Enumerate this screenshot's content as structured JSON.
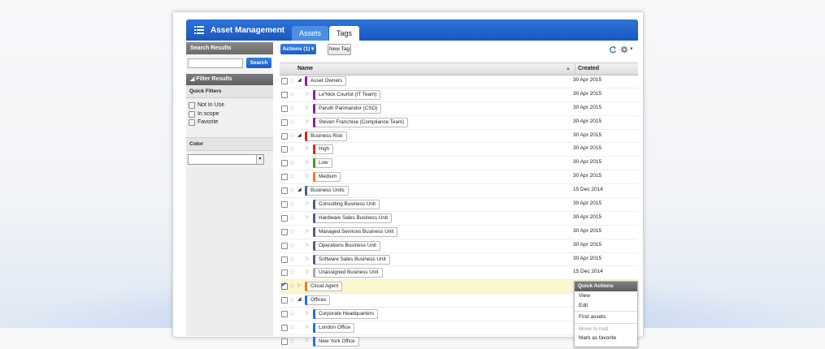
{
  "app": {
    "title": "Asset Management",
    "tabs": [
      "Assets",
      "Tags"
    ],
    "active_tab": "Tags"
  },
  "sidebar": {
    "search_header": "Search Results",
    "search_value": "",
    "search_button": "Search",
    "filter_header": "Filter Results",
    "quick_filters_label": "Quick Filters",
    "quick_filters": [
      "Not In Use",
      "In scope",
      "Favorite"
    ],
    "color_label": "Color",
    "color_value": ""
  },
  "toolbar": {
    "actions_label": "Actions (1)",
    "new_tag_label": "New Tag"
  },
  "table": {
    "columns": [
      "Name",
      "Created"
    ],
    "rows": [
      {
        "name": "Asset Owners",
        "created": "30 Apr 2015",
        "level": 0,
        "color": "#8a1e9e",
        "expanded": true,
        "checked": false
      },
      {
        "name": "Le'Nick Courtot (IT Team)",
        "created": "30 Apr 2015",
        "level": 1,
        "color": "#8a1e9e",
        "checked": false
      },
      {
        "name": "Paruth Parimandor (CSO)",
        "created": "30 Apr 2015",
        "level": 1,
        "color": "#8a1e9e",
        "checked": false
      },
      {
        "name": "Steven Franchise (Compliance Team)",
        "created": "30 Apr 2015",
        "level": 1,
        "color": "#8a1e9e",
        "checked": false
      },
      {
        "name": "Business Risk",
        "created": "30 Apr 2015",
        "level": 0,
        "color": "#e0231e",
        "expanded": true,
        "checked": false
      },
      {
        "name": "High",
        "created": "30 Apr 2015",
        "level": 1,
        "color": "#e0231e",
        "checked": false
      },
      {
        "name": "Low",
        "created": "30 Apr 2015",
        "level": 1,
        "color": "#3f9a2a",
        "checked": false
      },
      {
        "name": "Medium",
        "created": "30 Apr 2015",
        "level": 1,
        "color": "#f07a1a",
        "checked": false
      },
      {
        "name": "Business Units",
        "created": "15 Dec 2014",
        "level": 0,
        "color": "#4d5d84",
        "expanded": true,
        "checked": false
      },
      {
        "name": "Consulting Business Unit",
        "created": "30 Apr 2015",
        "level": 1,
        "color": "#4d5d84",
        "checked": false
      },
      {
        "name": "Hardware Sales Business Unit",
        "created": "30 Apr 2015",
        "level": 1,
        "color": "#4d5d84",
        "checked": false
      },
      {
        "name": "Managed Services Business Unit",
        "created": "30 Apr 2015",
        "level": 1,
        "color": "#4d5d84",
        "checked": false
      },
      {
        "name": "Operations Business Unit",
        "created": "30 Apr 2015",
        "level": 1,
        "color": "#4d5d84",
        "checked": false
      },
      {
        "name": "Software Sales Business Unit",
        "created": "30 Apr 2015",
        "level": 1,
        "color": "#4d5d84",
        "checked": false
      },
      {
        "name": "Unassigned Business Unit",
        "created": "15 Dec 2014",
        "level": 1,
        "color": "#aaaaaa",
        "checked": false
      },
      {
        "name": "Cloud Agent",
        "created": "",
        "level": 0,
        "color": "#f07a1a",
        "expanded": false,
        "checked": true
      },
      {
        "name": "Offices",
        "created": "",
        "level": 0,
        "color": "#1f6fe0",
        "expanded": true,
        "checked": false
      },
      {
        "name": "Corporate Headquarters",
        "created": "",
        "level": 1,
        "color": "#1f6fe0",
        "checked": false
      },
      {
        "name": "London Office",
        "created": "",
        "level": 1,
        "color": "#1f6fe0",
        "checked": false
      },
      {
        "name": "New York Office",
        "created": "",
        "level": 1,
        "color": "#1f6fe0",
        "checked": false
      }
    ]
  },
  "quick_actions": {
    "title": "Quick Actions",
    "items": [
      "View",
      "Edit",
      "Find assets",
      "Move to root",
      "Mark as favorite"
    ],
    "disabled": [
      "Move to root"
    ]
  },
  "colors": {
    "brand": "#1a57c0",
    "selected_row": "#fdf7cf"
  }
}
